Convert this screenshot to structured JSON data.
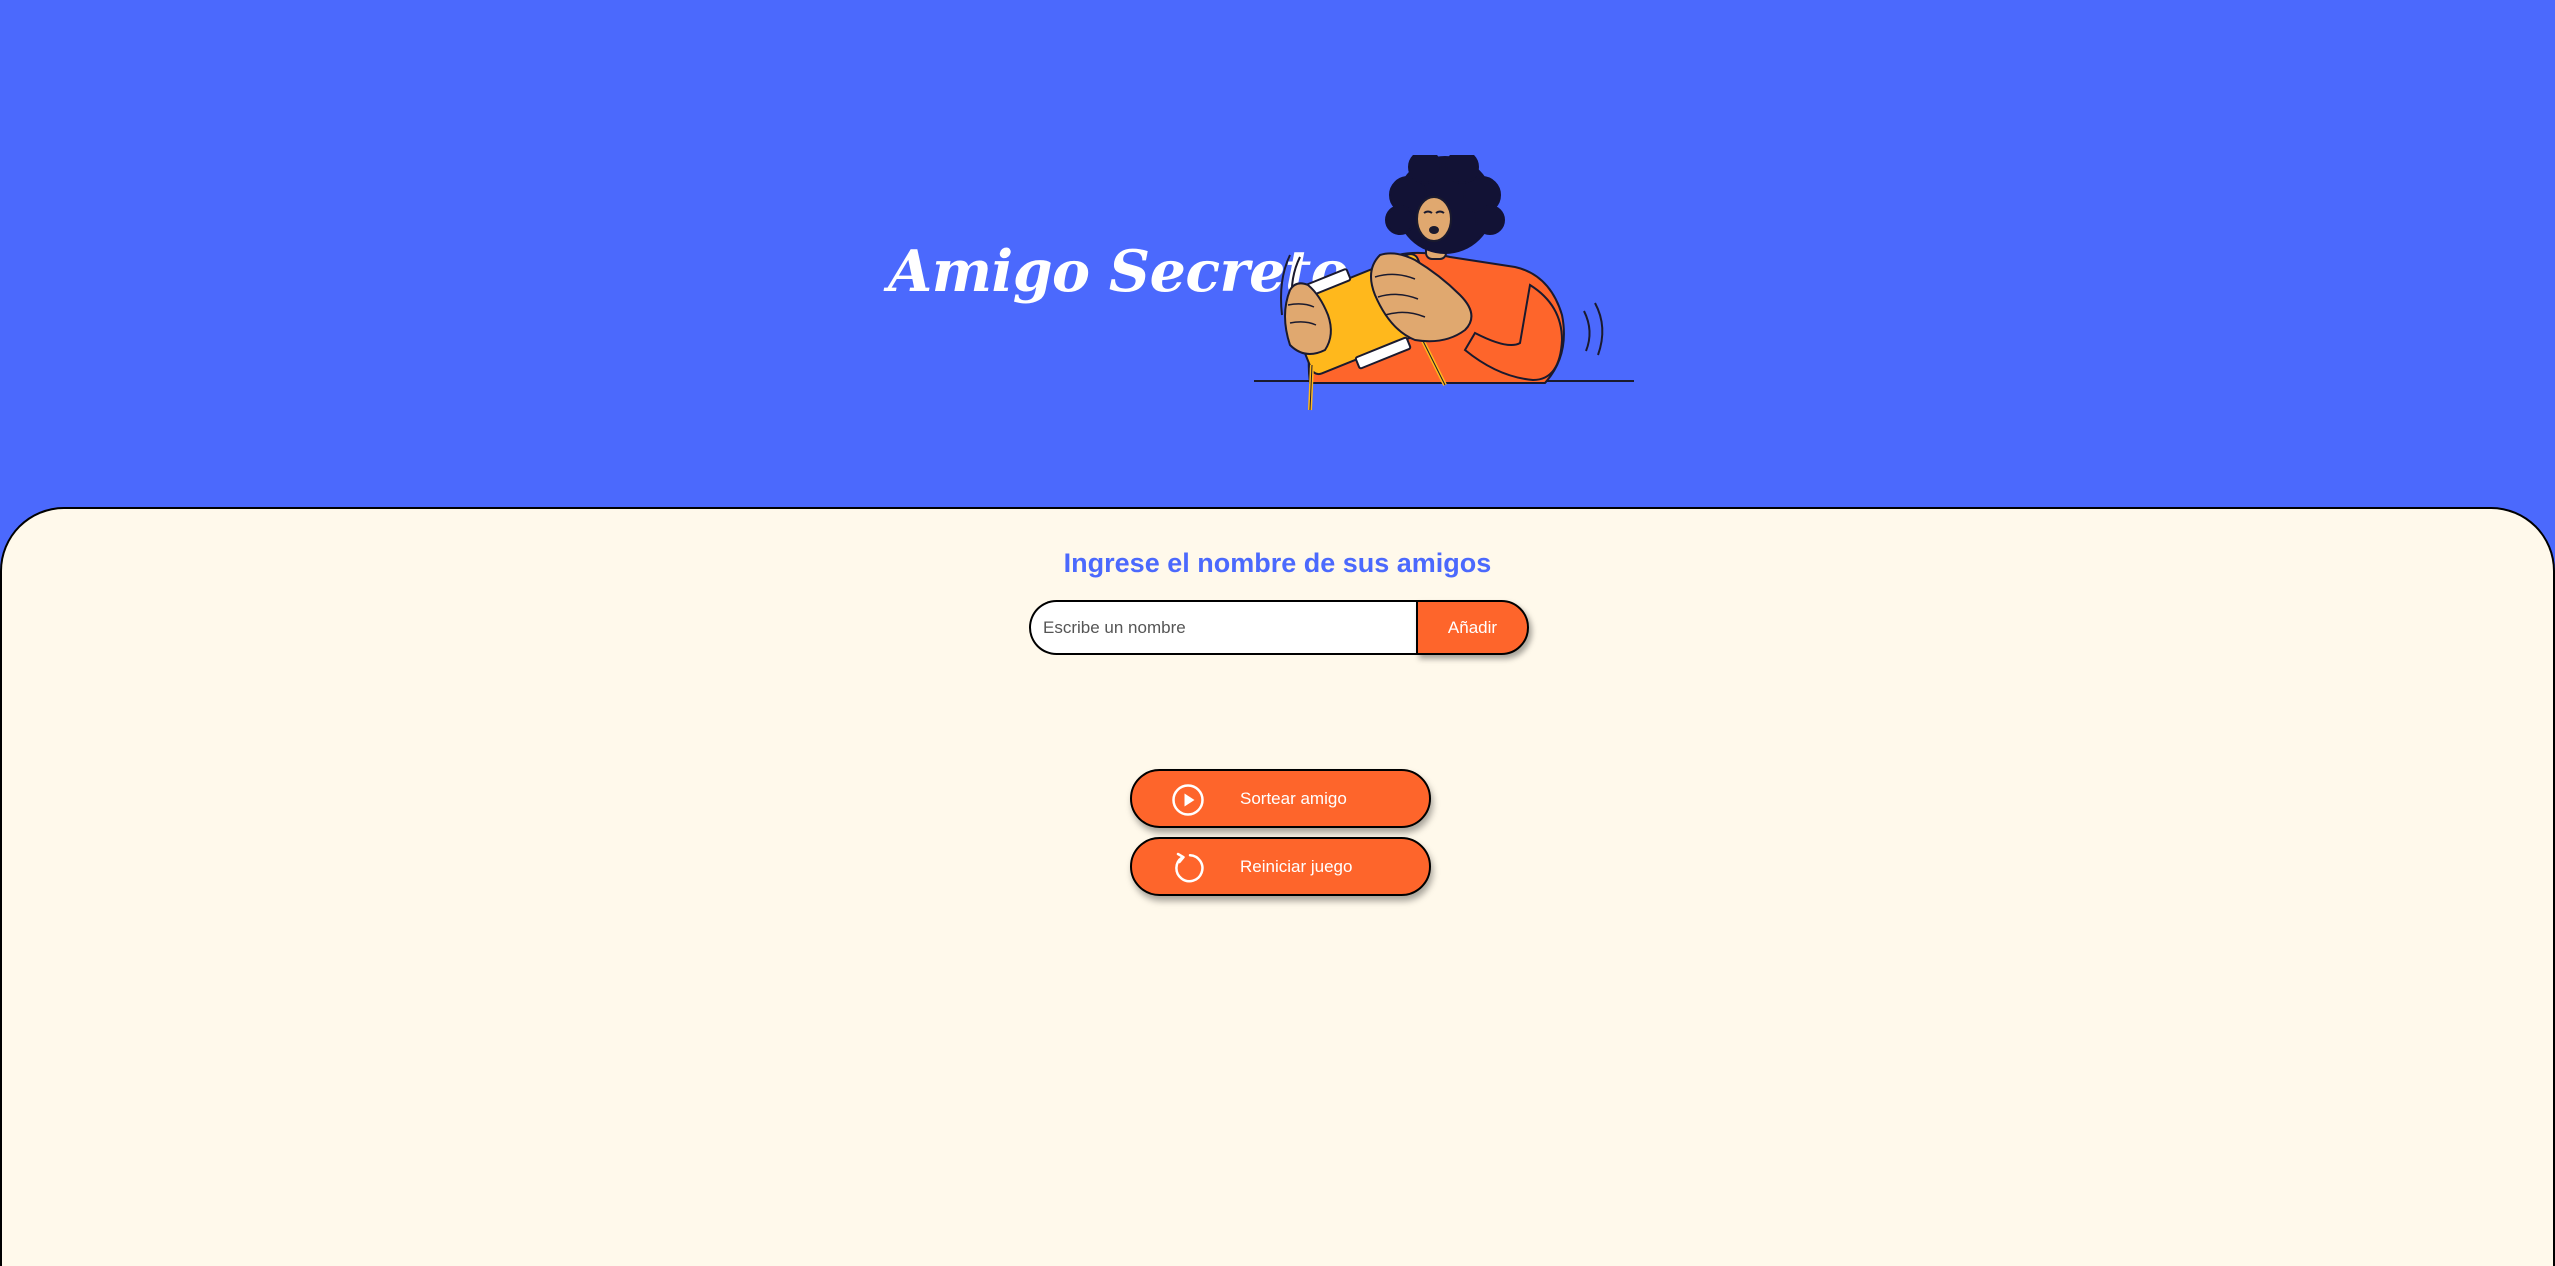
{
  "header": {
    "title": "Amigo Secreto",
    "illustration": "person-with-game-console-illustration",
    "background_color": "#4B69FD"
  },
  "main": {
    "subtitle": "Ingrese el nombre de sus amigos",
    "name_input": {
      "value": "",
      "placeholder": "Escribe un nombre"
    },
    "add_button_label": "Añadir",
    "friends_list": [],
    "result": [],
    "draw_button": {
      "label": "Sortear amigo",
      "icon": "play-circle-icon"
    },
    "reset_button": {
      "label": "Reiniciar juego",
      "icon": "refresh-icon"
    },
    "background_color": "#FFF9EB",
    "accent_color": "#FE652B"
  }
}
